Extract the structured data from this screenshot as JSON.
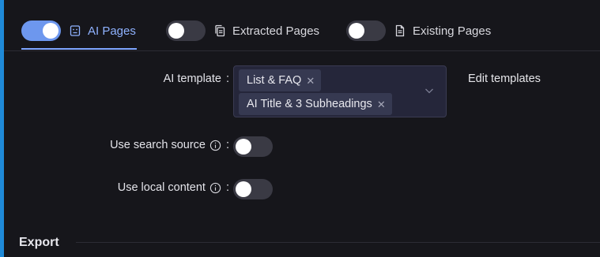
{
  "tabs": [
    {
      "label": "AI Pages",
      "icon": "robot-icon",
      "enabled": true,
      "active": true
    },
    {
      "label": "Extracted Pages",
      "icon": "copy-pages-icon",
      "enabled": false,
      "active": false
    },
    {
      "label": "Existing Pages",
      "icon": "document-icon",
      "enabled": false,
      "active": false
    }
  ],
  "form": {
    "ai_template": {
      "label": "AI template",
      "colon": ":",
      "selected": [
        "List & FAQ",
        "AI Title & 3 Subheadings"
      ],
      "remove_glyph": "✕",
      "edit_label": "Edit templates"
    },
    "search_source": {
      "label": "Use search source",
      "colon": ":",
      "enabled": false
    },
    "local_content": {
      "label": "Use local content",
      "colon": ":",
      "enabled": false
    }
  },
  "sections": {
    "export_title": "Export"
  },
  "colors": {
    "accent": "#6d97ee",
    "tab_active": "#8fb2ff",
    "background": "#16161b"
  }
}
